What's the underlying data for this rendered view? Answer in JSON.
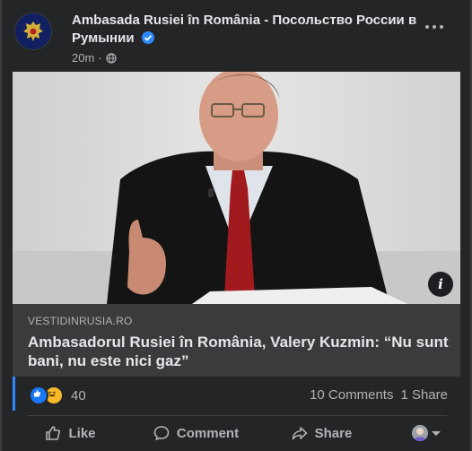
{
  "post": {
    "page_name": "Ambasada Rusiei în România - Посольство России в Румынии",
    "time": "20m",
    "audience_icon": "globe-icon"
  },
  "link": {
    "domain": "VESTIDINRUSIA.RO",
    "title": "Ambasadorul Rusiei în România, Valery Kuzmin: “Nu sunt bani, nu este nici gaz”"
  },
  "stats": {
    "reactions": "40",
    "comments": "10 Comments",
    "shares": "1 Share"
  },
  "actions": {
    "like": "Like",
    "comment": "Comment",
    "share": "Share"
  },
  "colors": {
    "card_bg": "#242526",
    "link_bg": "#3a3b3c",
    "accent": "#2d88ff",
    "like": "#1877f2",
    "haha": "#f7b928"
  }
}
